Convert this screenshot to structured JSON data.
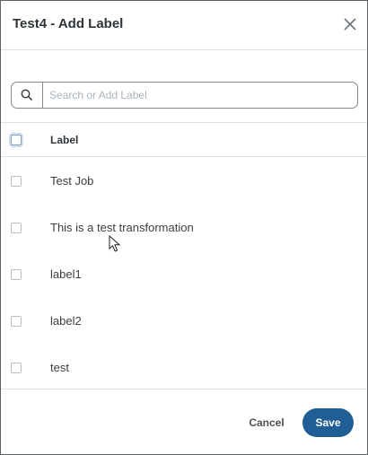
{
  "dialog": {
    "title": "Test4 - Add Label",
    "close_icon": "close-icon"
  },
  "search": {
    "icon": "search-icon",
    "placeholder": "Search or Add Label",
    "value": ""
  },
  "table": {
    "header": {
      "label": "Label"
    },
    "rows": [
      {
        "label": "Test Job",
        "checked": false
      },
      {
        "label": "This is a test transformation",
        "checked": false
      },
      {
        "label": "label1",
        "checked": false
      },
      {
        "label": "label2",
        "checked": false
      },
      {
        "label": "test",
        "checked": false
      }
    ]
  },
  "footer": {
    "cancel_label": "Cancel",
    "save_label": "Save"
  },
  "colors": {
    "primary_button": "#1f5f95",
    "border": "#dcdfe3"
  }
}
